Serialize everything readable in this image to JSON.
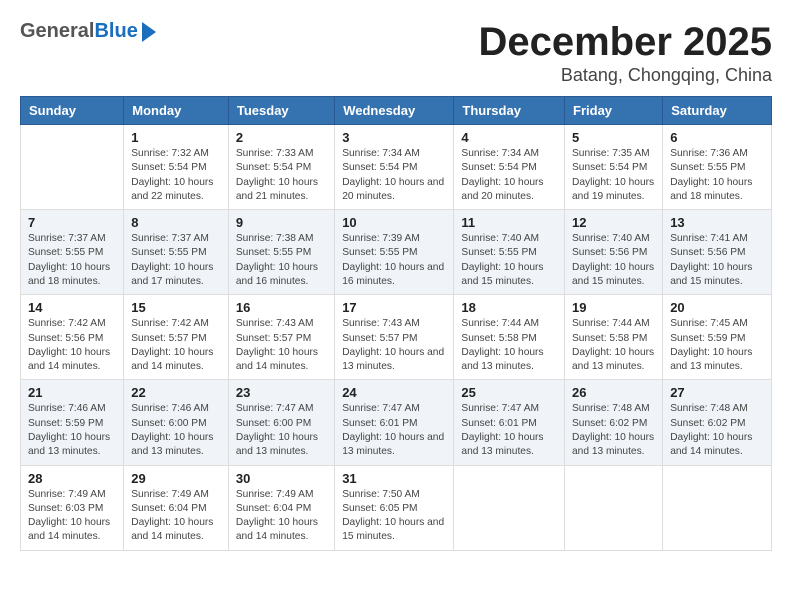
{
  "header": {
    "logo_general": "General",
    "logo_blue": "Blue",
    "month_title": "December 2025",
    "location": "Batang, Chongqing, China"
  },
  "days_of_week": [
    "Sunday",
    "Monday",
    "Tuesday",
    "Wednesday",
    "Thursday",
    "Friday",
    "Saturday"
  ],
  "weeks": [
    [
      {
        "day": "",
        "sunrise": "",
        "sunset": "",
        "daylight": ""
      },
      {
        "day": "1",
        "sunrise": "Sunrise: 7:32 AM",
        "sunset": "Sunset: 5:54 PM",
        "daylight": "Daylight: 10 hours and 22 minutes."
      },
      {
        "day": "2",
        "sunrise": "Sunrise: 7:33 AM",
        "sunset": "Sunset: 5:54 PM",
        "daylight": "Daylight: 10 hours and 21 minutes."
      },
      {
        "day": "3",
        "sunrise": "Sunrise: 7:34 AM",
        "sunset": "Sunset: 5:54 PM",
        "daylight": "Daylight: 10 hours and 20 minutes."
      },
      {
        "day": "4",
        "sunrise": "Sunrise: 7:34 AM",
        "sunset": "Sunset: 5:54 PM",
        "daylight": "Daylight: 10 hours and 20 minutes."
      },
      {
        "day": "5",
        "sunrise": "Sunrise: 7:35 AM",
        "sunset": "Sunset: 5:54 PM",
        "daylight": "Daylight: 10 hours and 19 minutes."
      },
      {
        "day": "6",
        "sunrise": "Sunrise: 7:36 AM",
        "sunset": "Sunset: 5:55 PM",
        "daylight": "Daylight: 10 hours and 18 minutes."
      }
    ],
    [
      {
        "day": "7",
        "sunrise": "Sunrise: 7:37 AM",
        "sunset": "Sunset: 5:55 PM",
        "daylight": "Daylight: 10 hours and 18 minutes."
      },
      {
        "day": "8",
        "sunrise": "Sunrise: 7:37 AM",
        "sunset": "Sunset: 5:55 PM",
        "daylight": "Daylight: 10 hours and 17 minutes."
      },
      {
        "day": "9",
        "sunrise": "Sunrise: 7:38 AM",
        "sunset": "Sunset: 5:55 PM",
        "daylight": "Daylight: 10 hours and 16 minutes."
      },
      {
        "day": "10",
        "sunrise": "Sunrise: 7:39 AM",
        "sunset": "Sunset: 5:55 PM",
        "daylight": "Daylight: 10 hours and 16 minutes."
      },
      {
        "day": "11",
        "sunrise": "Sunrise: 7:40 AM",
        "sunset": "Sunset: 5:55 PM",
        "daylight": "Daylight: 10 hours and 15 minutes."
      },
      {
        "day": "12",
        "sunrise": "Sunrise: 7:40 AM",
        "sunset": "Sunset: 5:56 PM",
        "daylight": "Daylight: 10 hours and 15 minutes."
      },
      {
        "day": "13",
        "sunrise": "Sunrise: 7:41 AM",
        "sunset": "Sunset: 5:56 PM",
        "daylight": "Daylight: 10 hours and 15 minutes."
      }
    ],
    [
      {
        "day": "14",
        "sunrise": "Sunrise: 7:42 AM",
        "sunset": "Sunset: 5:56 PM",
        "daylight": "Daylight: 10 hours and 14 minutes."
      },
      {
        "day": "15",
        "sunrise": "Sunrise: 7:42 AM",
        "sunset": "Sunset: 5:57 PM",
        "daylight": "Daylight: 10 hours and 14 minutes."
      },
      {
        "day": "16",
        "sunrise": "Sunrise: 7:43 AM",
        "sunset": "Sunset: 5:57 PM",
        "daylight": "Daylight: 10 hours and 14 minutes."
      },
      {
        "day": "17",
        "sunrise": "Sunrise: 7:43 AM",
        "sunset": "Sunset: 5:57 PM",
        "daylight": "Daylight: 10 hours and 13 minutes."
      },
      {
        "day": "18",
        "sunrise": "Sunrise: 7:44 AM",
        "sunset": "Sunset: 5:58 PM",
        "daylight": "Daylight: 10 hours and 13 minutes."
      },
      {
        "day": "19",
        "sunrise": "Sunrise: 7:44 AM",
        "sunset": "Sunset: 5:58 PM",
        "daylight": "Daylight: 10 hours and 13 minutes."
      },
      {
        "day": "20",
        "sunrise": "Sunrise: 7:45 AM",
        "sunset": "Sunset: 5:59 PM",
        "daylight": "Daylight: 10 hours and 13 minutes."
      }
    ],
    [
      {
        "day": "21",
        "sunrise": "Sunrise: 7:46 AM",
        "sunset": "Sunset: 5:59 PM",
        "daylight": "Daylight: 10 hours and 13 minutes."
      },
      {
        "day": "22",
        "sunrise": "Sunrise: 7:46 AM",
        "sunset": "Sunset: 6:00 PM",
        "daylight": "Daylight: 10 hours and 13 minutes."
      },
      {
        "day": "23",
        "sunrise": "Sunrise: 7:47 AM",
        "sunset": "Sunset: 6:00 PM",
        "daylight": "Daylight: 10 hours and 13 minutes."
      },
      {
        "day": "24",
        "sunrise": "Sunrise: 7:47 AM",
        "sunset": "Sunset: 6:01 PM",
        "daylight": "Daylight: 10 hours and 13 minutes."
      },
      {
        "day": "25",
        "sunrise": "Sunrise: 7:47 AM",
        "sunset": "Sunset: 6:01 PM",
        "daylight": "Daylight: 10 hours and 13 minutes."
      },
      {
        "day": "26",
        "sunrise": "Sunrise: 7:48 AM",
        "sunset": "Sunset: 6:02 PM",
        "daylight": "Daylight: 10 hours and 13 minutes."
      },
      {
        "day": "27",
        "sunrise": "Sunrise: 7:48 AM",
        "sunset": "Sunset: 6:02 PM",
        "daylight": "Daylight: 10 hours and 14 minutes."
      }
    ],
    [
      {
        "day": "28",
        "sunrise": "Sunrise: 7:49 AM",
        "sunset": "Sunset: 6:03 PM",
        "daylight": "Daylight: 10 hours and 14 minutes."
      },
      {
        "day": "29",
        "sunrise": "Sunrise: 7:49 AM",
        "sunset": "Sunset: 6:04 PM",
        "daylight": "Daylight: 10 hours and 14 minutes."
      },
      {
        "day": "30",
        "sunrise": "Sunrise: 7:49 AM",
        "sunset": "Sunset: 6:04 PM",
        "daylight": "Daylight: 10 hours and 14 minutes."
      },
      {
        "day": "31",
        "sunrise": "Sunrise: 7:50 AM",
        "sunset": "Sunset: 6:05 PM",
        "daylight": "Daylight: 10 hours and 15 minutes."
      },
      {
        "day": "",
        "sunrise": "",
        "sunset": "",
        "daylight": ""
      },
      {
        "day": "",
        "sunrise": "",
        "sunset": "",
        "daylight": ""
      },
      {
        "day": "",
        "sunrise": "",
        "sunset": "",
        "daylight": ""
      }
    ]
  ]
}
